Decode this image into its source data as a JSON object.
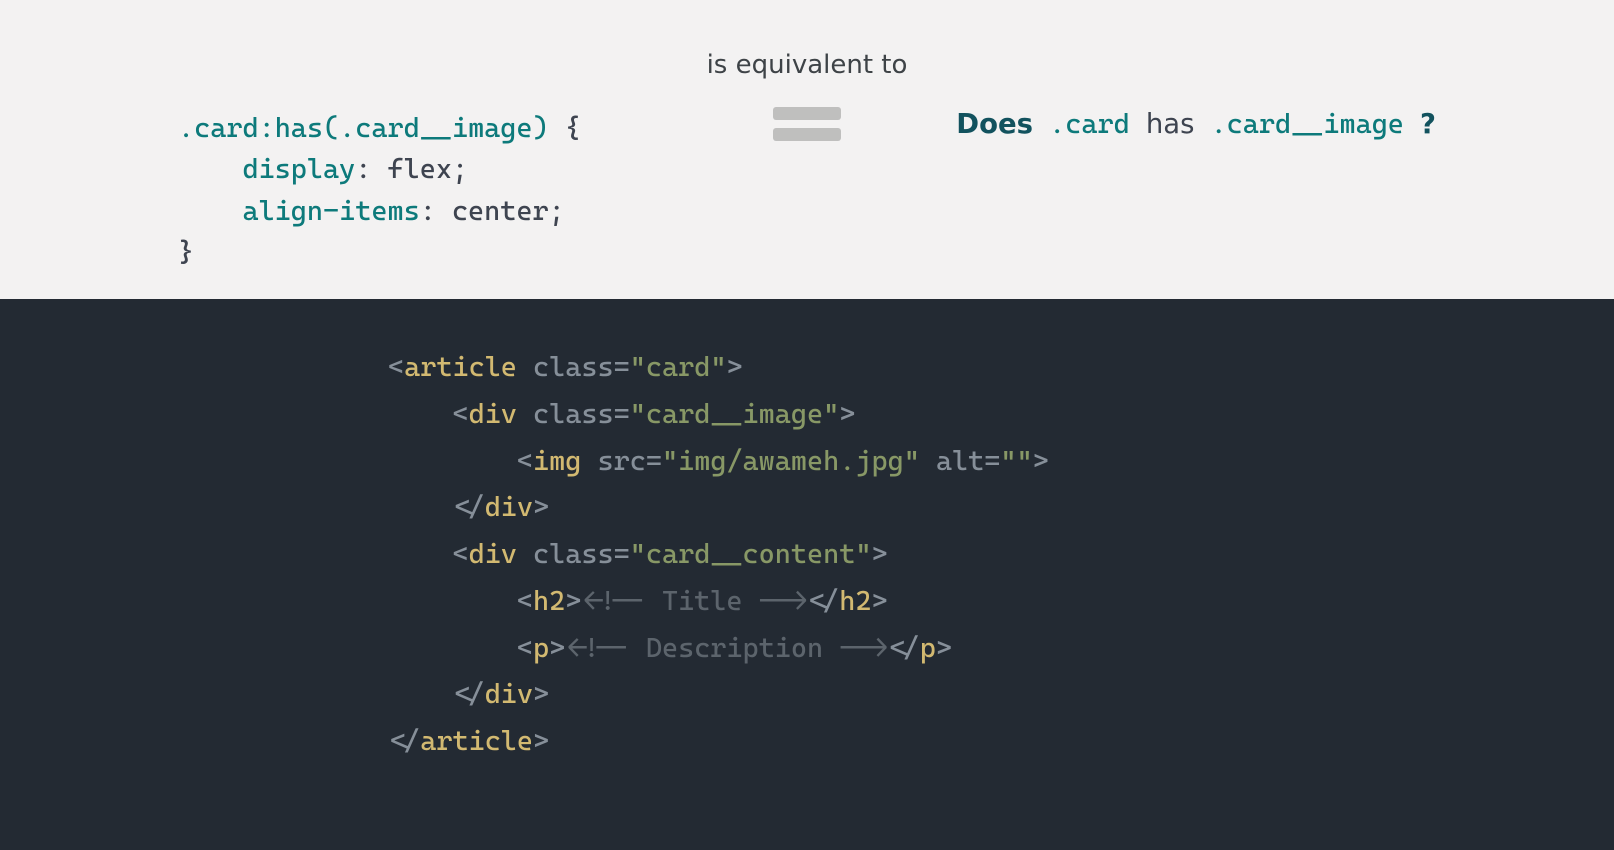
{
  "top": {
    "equiv_label": "is equivalent to",
    "css": {
      "sel_card": ".card",
      "sel_has": ":has(",
      "sel_image": ".card__image",
      "sel_close": ")",
      "brace_open": " {",
      "indent": "    ",
      "prop_display": "display",
      "colon_sp": ": ",
      "val_flex": "flex",
      "semi": ";",
      "prop_align": "align-items",
      "val_center": "center",
      "brace_close": "}"
    },
    "question": {
      "does": "Does",
      "sp": " ",
      "card": ".card",
      "has": "has",
      "image": ".card__image",
      "qmark": "?"
    }
  },
  "bottom": {
    "l1_open": "<",
    "l1_tag": "article",
    "l1_sp": " ",
    "l1_attr": "class",
    "l1_eq": "=",
    "l1_q": "\"",
    "l1_val": "card",
    "l1_close": ">",
    "pad1": "    ",
    "l2_open": "<",
    "l2_tag": "div",
    "l2_sp": " ",
    "l2_attr": "class",
    "l2_eq": "=",
    "l2_q": "\"",
    "l2_val": "card__image",
    "l2_close": ">",
    "pad2": "        ",
    "l3_open": "<",
    "l3_tag": "img",
    "l3_sp": " ",
    "l3_attr1": "src",
    "l3_eq": "=",
    "l3_q": "\"",
    "l3_val1": "img/awameh.jpg",
    "l3_sp2": " ",
    "l3_attr2": "alt",
    "l3_val2": "",
    "l3_close": ">",
    "l4_open": "</",
    "l4_tag": "div",
    "l4_close": ">",
    "l5_open": "<",
    "l5_tag": "div",
    "l5_sp": " ",
    "l5_attr": "class",
    "l5_eq": "=",
    "l5_q": "\"",
    "l5_val": "card__content",
    "l5_close": ">",
    "l6_open": "<",
    "l6_tag": "h2",
    "l6_close": ">",
    "l6_cmt": "<!-- Title -->",
    "l6_open2": "</",
    "l6_close2": ">",
    "l7_open": "<",
    "l7_tag": "p",
    "l7_close": ">",
    "l7_cmt": "<!-- Description -->",
    "l7_open2": "</",
    "l7_close2": ">",
    "l8_open": "</",
    "l8_tag": "div",
    "l8_close": ">",
    "l9_open": "</",
    "l9_tag": "article",
    "l9_close": ">"
  }
}
